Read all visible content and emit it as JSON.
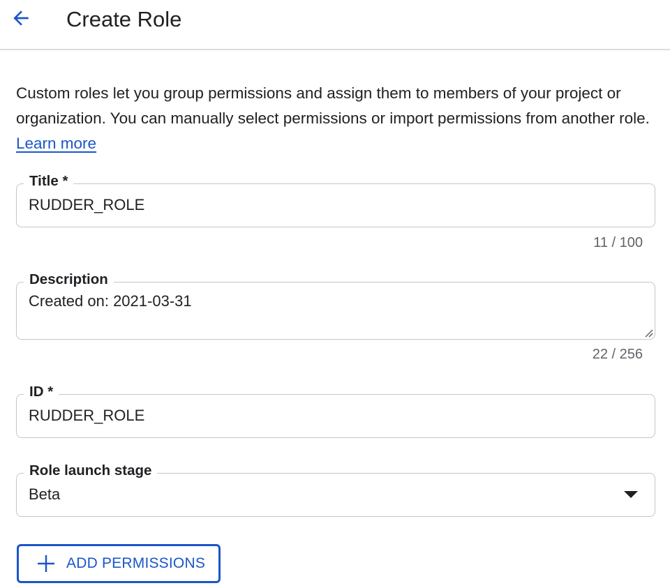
{
  "header": {
    "title": "Create Role",
    "back_icon": "arrow-left-icon"
  },
  "intro": {
    "text": "Custom roles let you group permissions and assign them to members of your project or organization. You can manually select permissions or import permissions from another role. ",
    "link_text": "Learn more"
  },
  "form": {
    "title_field": {
      "label": "Title *",
      "value": "RUDDER_ROLE",
      "counter": "11 / 100"
    },
    "description_field": {
      "label": "Description",
      "value": "Created on: 2021-03-31",
      "counter": "22 / 256"
    },
    "id_field": {
      "label": "ID *",
      "value": "RUDDER_ROLE"
    },
    "launch_stage_field": {
      "label": "Role launch stage",
      "selected": "Beta"
    }
  },
  "actions": {
    "add_permissions_label": "ADD PERMISSIONS",
    "add_icon": "plus-icon"
  },
  "colors": {
    "accent": "#1a56c9",
    "text": "#202124",
    "muted": "#5f6368",
    "border": "#c4c6ca"
  }
}
